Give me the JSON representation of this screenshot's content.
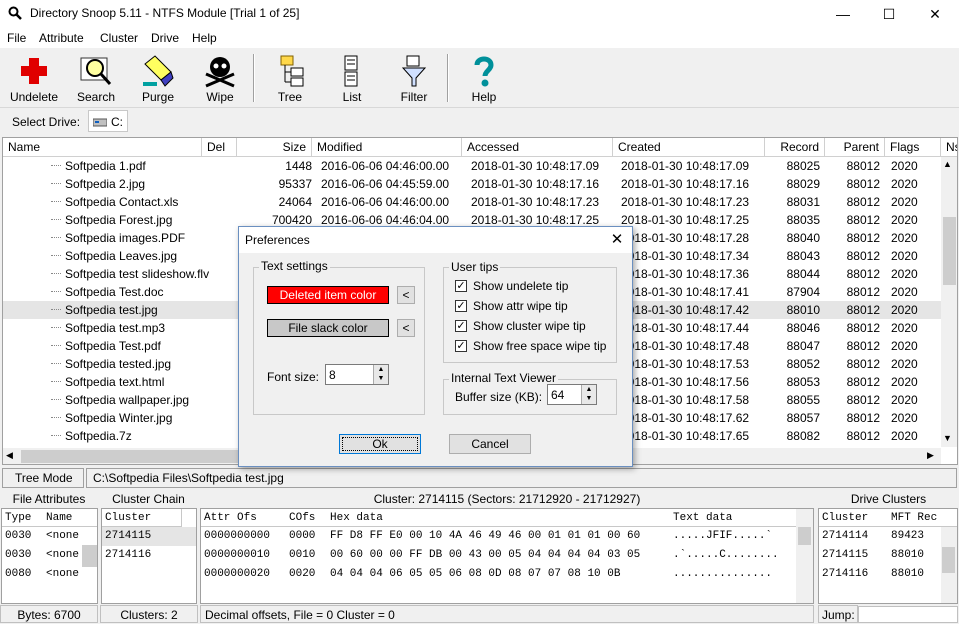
{
  "window": {
    "title": "Directory Snoop 5.11 - NTFS Module  [Trial 1 of 25]",
    "minimize": "—",
    "maximize": "☐",
    "close": "✕"
  },
  "menu": [
    "File",
    "Attribute",
    "Cluster",
    "Drive",
    "Help"
  ],
  "toolbar": {
    "undelete": "Undelete",
    "search": "Search",
    "purge": "Purge",
    "wipe": "Wipe",
    "tree": "Tree",
    "list": "List",
    "filter": "Filter",
    "help": "Help"
  },
  "drive": {
    "label": "Select Drive:",
    "value": "C:"
  },
  "filelist": {
    "headers": [
      "Name",
      "Del",
      "Size",
      "Modified",
      "Accessed",
      "Created",
      "Record",
      "Parent",
      "Flags",
      "Ns"
    ],
    "rows": [
      {
        "name": "Softpedia 1.pdf",
        "size": "1448",
        "modified": "2016-06-06  04:46:00.00",
        "accessed": "2018-01-30  10:48:17.09",
        "created": "2018-01-30  10:48:17.09",
        "record": "88025",
        "parent": "88012",
        "flags": "2020"
      },
      {
        "name": "Softpedia 2.jpg",
        "size": "95337",
        "modified": "2016-06-06  04:45:59.00",
        "accessed": "2018-01-30  10:48:17.16",
        "created": "2018-01-30  10:48:17.16",
        "record": "88029",
        "parent": "88012",
        "flags": "2020"
      },
      {
        "name": "Softpedia Contact.xls",
        "size": "24064",
        "modified": "2016-06-06  04:46:00.00",
        "accessed": "2018-01-30  10:48:17.23",
        "created": "2018-01-30  10:48:17.23",
        "record": "88031",
        "parent": "88012",
        "flags": "2020"
      },
      {
        "name": "Softpedia Forest.jpg",
        "size": "700420",
        "modified": "2016-06-06  04:46:04.00",
        "accessed": "2018-01-30  10:48:17.25",
        "created": "2018-01-30  10:48:17.25",
        "record": "88035",
        "parent": "88012",
        "flags": "2020"
      },
      {
        "name": "Softpedia images.PDF",
        "size": "",
        "modified": "",
        "accessed": "",
        "created": "2018-01-30  10:48:17.28",
        "record": "88040",
        "parent": "88012",
        "flags": "2020"
      },
      {
        "name": "Softpedia Leaves.jpg",
        "size": "",
        "modified": "",
        "accessed": "",
        "created": "2018-01-30  10:48:17.34",
        "record": "88043",
        "parent": "88012",
        "flags": "2020"
      },
      {
        "name": "Softpedia test slideshow.flv",
        "size": "",
        "modified": "",
        "accessed": "",
        "created": "2018-01-30  10:48:17.36",
        "record": "88044",
        "parent": "88012",
        "flags": "2020"
      },
      {
        "name": "Softpedia Test.doc",
        "size": "",
        "modified": "",
        "accessed": "",
        "created": "2018-01-30  10:48:17.41",
        "record": "87904",
        "parent": "88012",
        "flags": "2020"
      },
      {
        "name": "Softpedia test.jpg",
        "size": "",
        "modified": "",
        "accessed": "",
        "created": "2018-01-30  10:48:17.42",
        "record": "88010",
        "parent": "88012",
        "flags": "2020",
        "selected": true
      },
      {
        "name": "Softpedia test.mp3",
        "size": "",
        "modified": "",
        "accessed": "",
        "created": "2018-01-30  10:48:17.44",
        "record": "88046",
        "parent": "88012",
        "flags": "2020"
      },
      {
        "name": "Softpedia Test.pdf",
        "size": "",
        "modified": "",
        "accessed": "",
        "created": "2018-01-30  10:48:17.48",
        "record": "88047",
        "parent": "88012",
        "flags": "2020"
      },
      {
        "name": "Softpedia tested.jpg",
        "size": "",
        "modified": "",
        "accessed": "",
        "created": "2018-01-30  10:48:17.53",
        "record": "88052",
        "parent": "88012",
        "flags": "2020"
      },
      {
        "name": "Softpedia text.html",
        "size": "",
        "modified": "",
        "accessed": "",
        "created": "2018-01-30  10:48:17.56",
        "record": "88053",
        "parent": "88012",
        "flags": "2020"
      },
      {
        "name": "Softpedia wallpaper.jpg",
        "size": "",
        "modified": "",
        "accessed": "",
        "created": "2018-01-30  10:48:17.58",
        "record": "88055",
        "parent": "88012",
        "flags": "2020"
      },
      {
        "name": "Softpedia Winter.jpg",
        "size": "",
        "modified": "",
        "accessed": "",
        "created": "2018-01-30  10:48:17.62",
        "record": "88057",
        "parent": "88012",
        "flags": "2020"
      },
      {
        "name": "Softpedia.7z",
        "size": "",
        "modified": "",
        "accessed": "",
        "created": "2018-01-30  10:48:17.65",
        "record": "88082",
        "parent": "88012",
        "flags": "2020"
      }
    ]
  },
  "status": {
    "tree_mode": "Tree Mode",
    "path": "C:\\Softpedia Files\\Softpedia test.jpg"
  },
  "file_attributes": {
    "title": "File Attributes",
    "headers": [
      "Type",
      "Name"
    ],
    "rows": [
      [
        "0030",
        "<none"
      ],
      [
        "0030",
        "<none"
      ],
      [
        "0080",
        "<none"
      ]
    ],
    "footer": "Bytes: 6700"
  },
  "cluster_chain": {
    "title": "Cluster Chain",
    "header": "Cluster",
    "rows": [
      "2714115",
      "2714116"
    ],
    "footer": "Clusters: 2"
  },
  "cluster_view": {
    "title": "Cluster: 2714115  (Sectors: 21712920 - 21712927)",
    "headers": [
      "Attr Ofs",
      "COfs",
      "Hex data",
      "Text data"
    ],
    "rows": [
      [
        "0000000000",
        "0000",
        "FF D8 FF E0 00 10 4A 46 49 46 00 01 01 01 00 60",
        ".....JFIF.....`"
      ],
      [
        "0000000010",
        "0010",
        "00 60 00 00 FF DB 00 43 00 05 04 04 04 04 03 05",
        ".`.....C........"
      ],
      [
        "0000000020",
        "0020",
        "04 04 04 06 05 05 06 08 0D 08 07 07 08 10 0B",
        "..............."
      ]
    ],
    "footer": "Decimal offsets, File = 0  Cluster = 0"
  },
  "drive_clusters": {
    "title": "Drive Clusters",
    "headers": [
      "Cluster",
      "MFT Rec"
    ],
    "rows": [
      [
        "2714114",
        "89423"
      ],
      [
        "2714115",
        "88010"
      ],
      [
        "2714116",
        "88010"
      ]
    ],
    "footer": "Jump:"
  },
  "dialog": {
    "title": "Preferences",
    "close": "✕",
    "text_settings": "Text settings",
    "deleted_color_label": "Deleted item color",
    "file_slack_label": "File slack color",
    "picker_arrow": "<",
    "font_size_label": "Font size:",
    "font_size_value": "8",
    "user_tips": "User tips",
    "tips": [
      "Show undelete tip",
      "Show attr wipe tip",
      "Show cluster wipe tip",
      "Show free space wipe tip"
    ],
    "check_mark": "✓",
    "internal_viewer": "Internal Text Viewer",
    "buffer_label": "Buffer size (KB):",
    "buffer_value": "64",
    "ok": "Ok",
    "cancel": "Cancel",
    "spin_up": "▲",
    "spin_down": "▼"
  },
  "colors": {
    "deleted": "#ff0000",
    "slack": "#c8c8c8",
    "selection": "#e5e5e5"
  }
}
